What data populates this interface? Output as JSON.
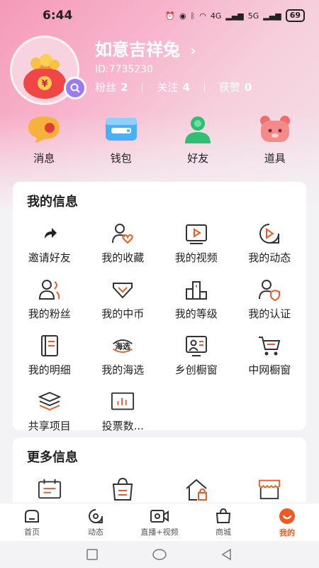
{
  "status": {
    "time": "6:44",
    "network": "4G",
    "network2": "5G",
    "battery": "69"
  },
  "profile": {
    "name": "如意吉祥兔",
    "id": "ID:7735230",
    "fans_label": "粉丝",
    "fans_count": "2",
    "follow_label": "关注",
    "follow_count": "4",
    "likes_label": "获赞",
    "likes_count": "0",
    "avatar_badge": "¥"
  },
  "quick": [
    {
      "label": "消息",
      "icon": "message-bubble-icon"
    },
    {
      "label": "钱包",
      "icon": "wallet-icon"
    },
    {
      "label": "好友",
      "icon": "friend-icon"
    },
    {
      "label": "道具",
      "icon": "bear-props-icon"
    }
  ],
  "my_info": {
    "title": "我的信息",
    "items": [
      {
        "label": "邀请好友",
        "icon": "share-arrow-icon"
      },
      {
        "label": "我的收藏",
        "icon": "user-heart-icon"
      },
      {
        "label": "我的视频",
        "icon": "video-play-icon"
      },
      {
        "label": "我的动态",
        "icon": "moment-play-icon"
      },
      {
        "label": "我的粉丝",
        "icon": "fans-icon"
      },
      {
        "label": "我的中币",
        "icon": "coin-diamond-icon"
      },
      {
        "label": "我的等级",
        "icon": "level-bars-icon"
      },
      {
        "label": "我的认证",
        "icon": "user-shield-icon"
      },
      {
        "label": "我的明细",
        "icon": "ledger-icon"
      },
      {
        "label": "我的海选",
        "icon": "haixuan-icon",
        "badge": "海选"
      },
      {
        "label": "乡创橱窗",
        "icon": "showcase-person-icon"
      },
      {
        "label": "中网橱窗",
        "icon": "cart-icon"
      },
      {
        "label": "共享项目",
        "icon": "layers-icon"
      },
      {
        "label": "投票数...",
        "icon": "vote-chart-icon"
      }
    ]
  },
  "more_info": {
    "title": "更多信息",
    "items": [
      {
        "icon": "calendar-list-icon"
      },
      {
        "icon": "bag-list-icon"
      },
      {
        "icon": "home-lock-icon"
      },
      {
        "icon": "store-icon"
      }
    ]
  },
  "tabs": [
    {
      "label": "首页",
      "icon": "home-tab-icon"
    },
    {
      "label": "动态",
      "icon": "dynamic-tab-icon"
    },
    {
      "label": "直播+视频",
      "icon": "camera-tab-icon"
    },
    {
      "label": "商城",
      "icon": "mall-tab-icon"
    },
    {
      "label": "我的",
      "icon": "mine-tab-icon",
      "active": true
    }
  ],
  "colors": {
    "accent": "#f05a22",
    "header_pink": "#f59ab8",
    "icon_dark": "#333333"
  }
}
